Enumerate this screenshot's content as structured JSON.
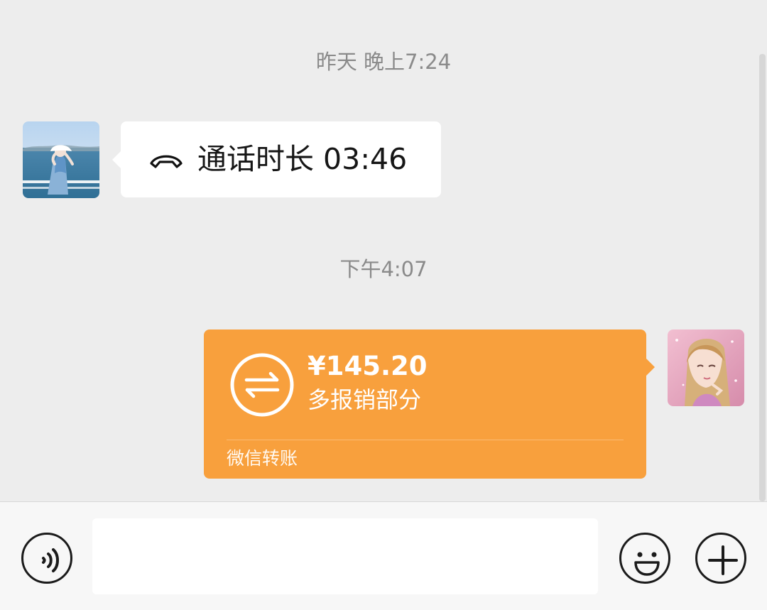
{
  "messages": {
    "timestamp_1": "昨天 晚上7:24",
    "call": {
      "label": "通话时长 03:46",
      "icon": "phone-hangup-icon"
    },
    "timestamp_2": "下午4:07",
    "transfer": {
      "amount": "¥145.20",
      "note": "多报销部分",
      "footer": "微信转账",
      "icon": "transfer-icon",
      "accent": "#f8a03d"
    }
  },
  "input_bar": {
    "voice_icon": "voice-icon",
    "emoji_icon": "emoji-icon",
    "plus_icon": "plus-icon",
    "placeholder": ""
  },
  "colors": {
    "background": "#ededed",
    "bubble_left": "#ffffff",
    "timestamp_text": "#8a8a8a",
    "transfer": "#f8a03d"
  }
}
